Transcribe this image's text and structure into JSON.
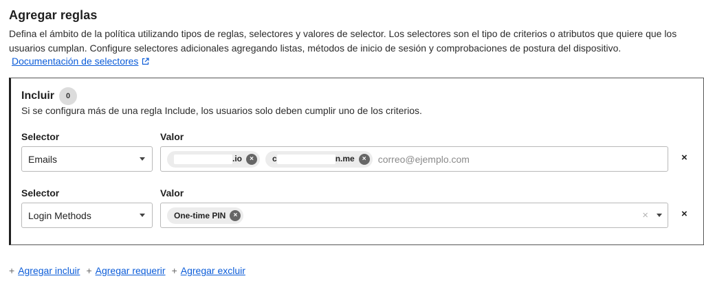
{
  "header": {
    "title": "Agregar reglas",
    "description": "Defina el ámbito de la política utilizando tipos de reglas, selectores y valores de selector. Los selectores son el tipo de criterios o atributos que quiere que los usuarios cumplan. Configure selectores adicionales agregando listas, métodos de inicio de sesión y comprobaciones de postura del dispositivo.",
    "doc_link": "Documentación de selectores"
  },
  "include": {
    "title": "Incluir",
    "count": "0",
    "subtitle": "Si se configura más de una regla Include, los usuarios solo deben cumplir uno de los criterios.",
    "rules": [
      {
        "selector_label": "Selector",
        "value_label": "Valor",
        "selector": "Emails",
        "chips": [
          {
            "prefix": "",
            "suffix": ".io"
          },
          {
            "prefix": "c",
            "suffix": "n.me"
          }
        ],
        "placeholder": "correo@ejemplo.com"
      },
      {
        "selector_label": "Selector",
        "value_label": "Valor",
        "selector": "Login Methods",
        "chips": [
          {
            "text": "One-time PIN"
          }
        ]
      }
    ]
  },
  "actions": {
    "add_include": "Agregar incluir",
    "add_require": "Agregar requerir",
    "add_exclude": "Agregar excluir"
  },
  "icons": {
    "remove_chip": "×",
    "remove_row": "×",
    "clear": "×"
  },
  "colors": {
    "link": "#0a5bd8",
    "chip_bg": "#ececec",
    "chip_remove_bg": "#666666",
    "panel_border": "#555555"
  }
}
